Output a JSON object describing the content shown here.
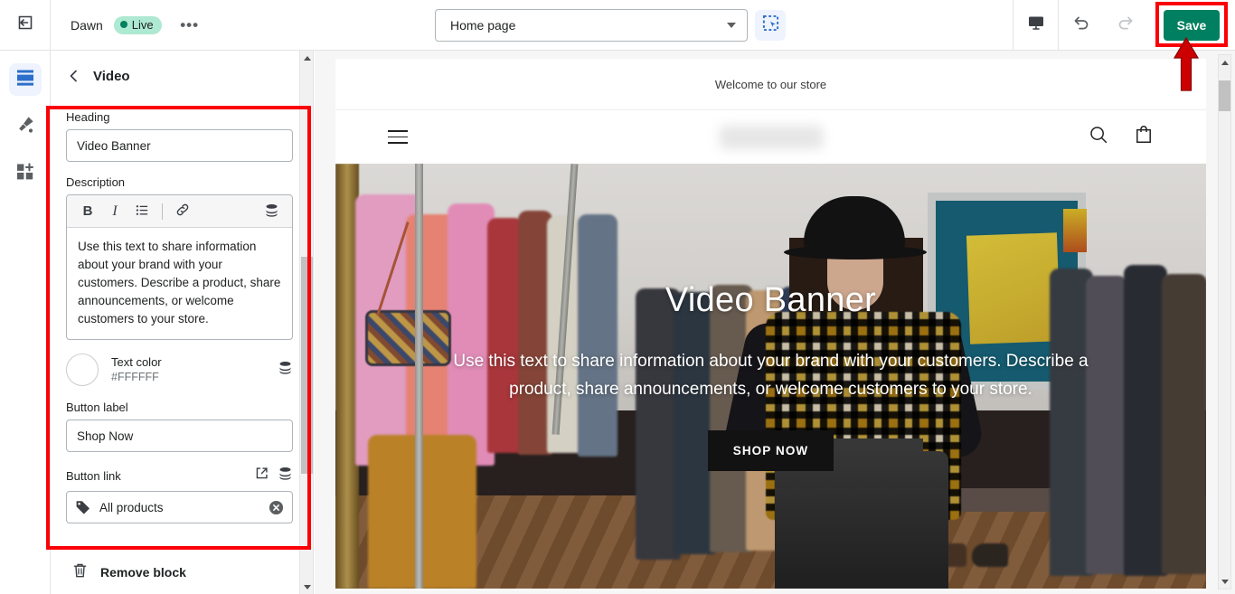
{
  "topbar": {
    "exit_icon": "exit-editor-icon",
    "theme_name": "Dawn",
    "status_badge": "Live",
    "more_label": "•••",
    "page_selector": {
      "value": "Home page",
      "caret_icon": "chevron-down-icon"
    },
    "inspector_icon": "select-section-icon",
    "device_icon": "desktop-preview-icon",
    "undo_icon": "undo-icon",
    "redo_icon": "redo-icon",
    "save_label": "Save",
    "save_color": "#008060"
  },
  "rail": {
    "items": [
      {
        "name": "sections-icon",
        "label": "Sections",
        "active": true
      },
      {
        "name": "theme-settings-icon",
        "label": "Theme settings",
        "active": false
      },
      {
        "name": "app-blocks-icon",
        "label": "App blocks",
        "active": false
      }
    ]
  },
  "panel": {
    "back_icon": "chevron-left-icon",
    "title": "Video",
    "heading": {
      "label": "Heading",
      "value": "Video Banner"
    },
    "description": {
      "label": "Description",
      "toolbar": {
        "bold": "B",
        "italic": "I",
        "bullet_list": "bullet-list-icon",
        "link": "link-icon",
        "dynamic_source": "dynamic-source-icon"
      },
      "value": "Use this text to share information about your brand with your customers. Describe a product, share announcements, or welcome customers to your store."
    },
    "text_color": {
      "label": "Text color",
      "hex": "#FFFFFF",
      "dynamic_source": "dynamic-source-icon"
    },
    "button_label": {
      "label": "Button label",
      "value": "Shop Now"
    },
    "button_link": {
      "label": "Button link",
      "value": "All products",
      "tag_icon": "tag-icon",
      "clear_icon": "clear-icon",
      "external_icon": "external-link-icon",
      "dynamic_source": "dynamic-source-icon"
    },
    "remove_block": {
      "label": "Remove block",
      "icon": "trash-icon"
    }
  },
  "preview": {
    "announcement": "Welcome to our store",
    "header": {
      "menu_icon": "hamburger-menu-icon",
      "logo": "store-logo",
      "search_icon": "search-icon",
      "cart_icon": "shopping-bag-icon"
    },
    "hero": {
      "heading": "Video Banner",
      "paragraph": "Use this text to share information about your brand with your customers. Describe a product, share announcements, or welcome customers to your store.",
      "button_label": "SHOP NOW",
      "text_color": "#FFFFFF",
      "button_background": "#121212"
    }
  },
  "annotations": {
    "panel_highlight": "red-rectangle-settings-panel",
    "save_highlight": "red-rectangle-save-button",
    "arrow": "red-arrow-pointing-to-save",
    "color": "#FB0007"
  }
}
